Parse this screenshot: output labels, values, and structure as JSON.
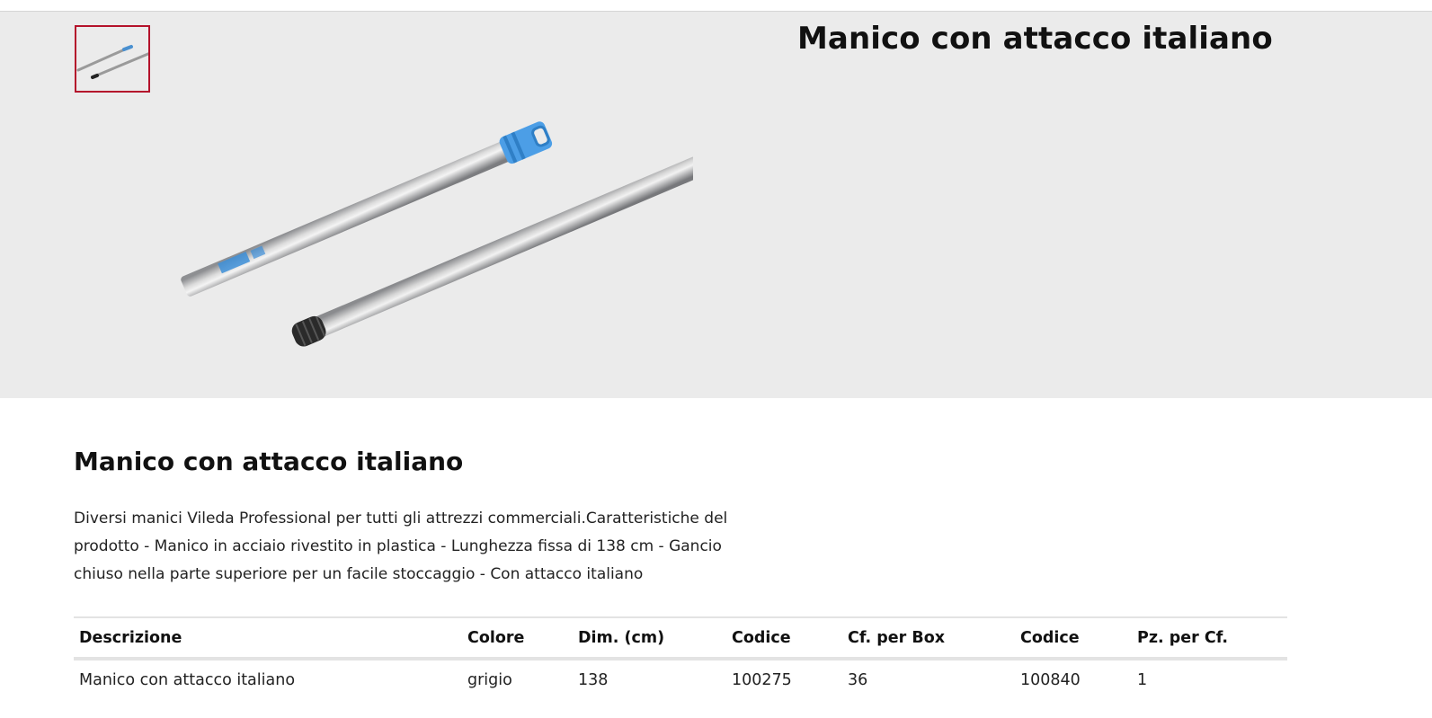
{
  "product": {
    "title": "Manico con attacco italiano",
    "section_title": "Manico con attacco italiano",
    "description": "Diversi manici Vileda Professional per tutti gli attrezzi commerciali.Caratteristiche del prodotto - Manico in acciaio rivestito in plastica - Lunghezza fissa di 138 cm - Gancio chiuso nella parte superiore per un facile stoccaggio - Con attacco italiano"
  },
  "gallery": {
    "thumbnail_icon": "broom-handle-thumbnail",
    "main_image_icon": "broom-handle-image",
    "accent_color": "#b4122b"
  },
  "table": {
    "headers": [
      "Descrizione",
      "Colore",
      "Dim. (cm)",
      "Codice",
      "Cf. per Box",
      "Codice",
      "Pz. per Cf."
    ],
    "rows": [
      [
        "Manico con attacco italiano",
        "grigio",
        "138",
        "100275",
        "36",
        "100840",
        "1"
      ]
    ]
  }
}
